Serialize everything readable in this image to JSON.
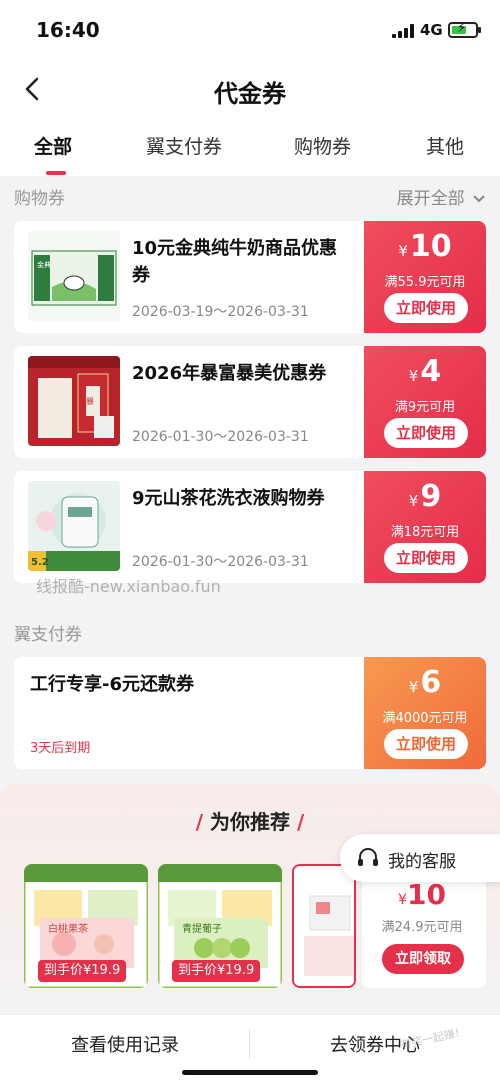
{
  "status": {
    "time": "16:40",
    "network": "4G"
  },
  "header": {
    "title": "代金券"
  },
  "tabs": [
    {
      "label": "全部",
      "active": true
    },
    {
      "label": "翼支付券",
      "active": false
    },
    {
      "label": "购物券",
      "active": false
    },
    {
      "label": "其他",
      "active": false
    }
  ],
  "shopping": {
    "section_title": "购物券",
    "expand_label": "展开全部",
    "coupons": [
      {
        "name": "10元金典纯牛奶商品优惠券",
        "date": "2026-03-19～2026-03-31",
        "currency": "¥",
        "amount": "10",
        "condition": "满55.9元可用",
        "button": "立即使用",
        "image_label": "金典"
      },
      {
        "name": "2026年暴富暴美优惠券",
        "date": "2026-01-30～2026-03-31",
        "currency": "¥",
        "amount": "4",
        "condition": "满9元可用",
        "button": "立即使用",
        "image_label": "暴富"
      },
      {
        "name": "9元山茶花洗衣液购物券",
        "date": "2026-01-30～2026-03-31",
        "currency": "¥",
        "amount": "9",
        "condition": "满18元可用",
        "button": "立即使用",
        "image_label": "山茶花香"
      }
    ]
  },
  "watermark": "线报酷-new.xianbao.fun",
  "yizhifu": {
    "section_title": "翼支付券",
    "coupon": {
      "name": "工行专享-6元还款券",
      "expire": "3天后到期",
      "currency": "¥",
      "amount": "6",
      "condition": "满4000元可用",
      "button": "立即使用"
    }
  },
  "recommend": {
    "title": "为你推荐",
    "cards": [
      {
        "price": "到手价¥19.9",
        "label": "白桃果茶"
      },
      {
        "price": "到手价¥19.9",
        "label": "青提葡子"
      }
    ],
    "coupon": {
      "currency": "¥",
      "amount": "10",
      "condition": "满24.9元可用",
      "button": "立即领取"
    }
  },
  "service": {
    "label": "我的客服"
  },
  "bottom": {
    "history": "查看使用记录",
    "get_more": "去领券中心"
  },
  "corner_watermark": "有奖一起赚！"
}
